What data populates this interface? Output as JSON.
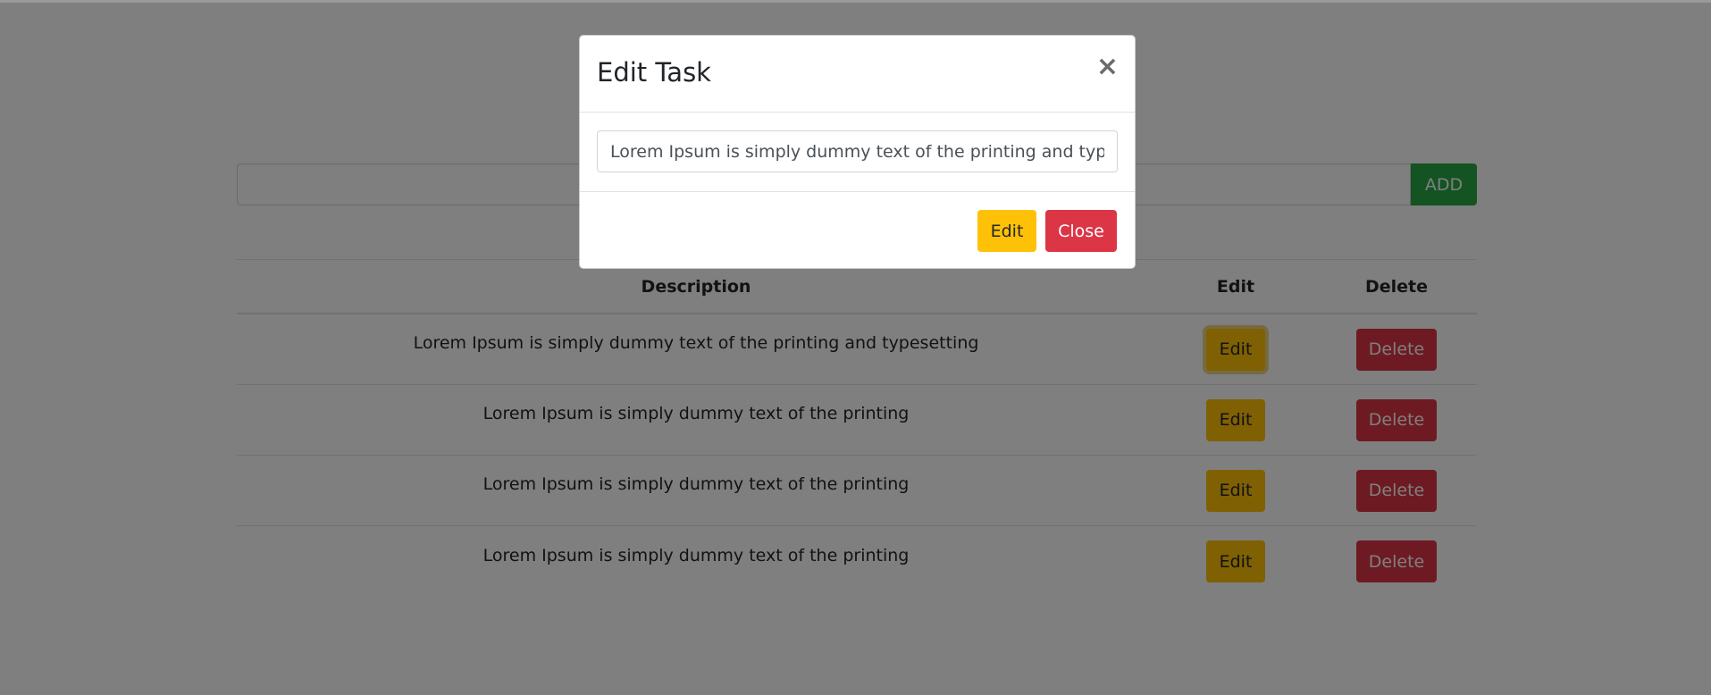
{
  "task_form": {
    "input_value": "",
    "add_label": "ADD"
  },
  "table": {
    "headers": {
      "description": "Description",
      "edit": "Edit",
      "delete": "Delete"
    },
    "rows": [
      {
        "description": "Lorem Ipsum is simply dummy text of the printing and typesetting",
        "edit_label": "Edit",
        "delete_label": "Delete"
      },
      {
        "description": "Lorem Ipsum is simply dummy text of the printing",
        "edit_label": "Edit",
        "delete_label": "Delete"
      },
      {
        "description": "Lorem Ipsum is simply dummy text of the printing",
        "edit_label": "Edit",
        "delete_label": "Delete"
      },
      {
        "description": "Lorem Ipsum is simply dummy text of the printing",
        "edit_label": "Edit",
        "delete_label": "Delete"
      }
    ]
  },
  "modal": {
    "title": "Edit Task",
    "close_icon": "close-icon",
    "close_glyph": "×",
    "input_value": "Lorem Ipsum is simply dummy text of the printing and typesetting",
    "edit_label": "Edit",
    "close_label": "Close"
  },
  "colors": {
    "success": "#28a745",
    "warning": "#ffc107",
    "danger": "#dc3545",
    "backdrop": "rgba(0,0,0,0.5)"
  }
}
